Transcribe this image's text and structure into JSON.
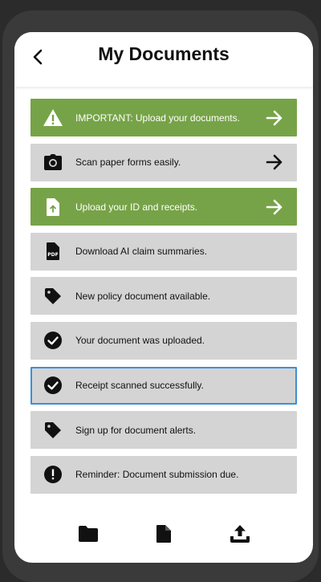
{
  "header": {
    "title": "My Documents",
    "back_icon": "chevron-left-icon"
  },
  "items": [
    {
      "label": "IMPORTANT: Upload your documents.",
      "icon": "warning-icon",
      "style": "green",
      "arrow": true
    },
    {
      "label": "Scan paper forms easily.",
      "icon": "camera-icon",
      "style": "gray",
      "arrow": true
    },
    {
      "label": "Upload your ID and receipts.",
      "icon": "file-upload-icon",
      "style": "green",
      "arrow": true
    },
    {
      "label": "Download AI claim summaries.",
      "icon": "pdf-icon",
      "style": "gray",
      "arrow": false
    },
    {
      "label": "New policy document available.",
      "icon": "tag-icon",
      "style": "gray",
      "arrow": false
    },
    {
      "label": "Your document was uploaded.",
      "icon": "check-circle-icon",
      "style": "gray",
      "arrow": false
    },
    {
      "label": "Receipt scanned successfully.",
      "icon": "check-circle-icon",
      "style": "gray",
      "arrow": false,
      "selected": true
    },
    {
      "label": "Sign up for document alerts.",
      "icon": "tag-icon",
      "style": "gray",
      "arrow": false
    },
    {
      "label": "Reminder: Document submission due.",
      "icon": "alert-circle-icon",
      "style": "gray",
      "arrow": false
    }
  ],
  "bottom_nav": [
    {
      "icon": "folder-icon"
    },
    {
      "icon": "document-icon"
    },
    {
      "icon": "upload-icon"
    }
  ],
  "colors": {
    "accent_green": "#76a347",
    "row_gray": "#d4d4d4",
    "selected_border": "#3d8fd9"
  }
}
